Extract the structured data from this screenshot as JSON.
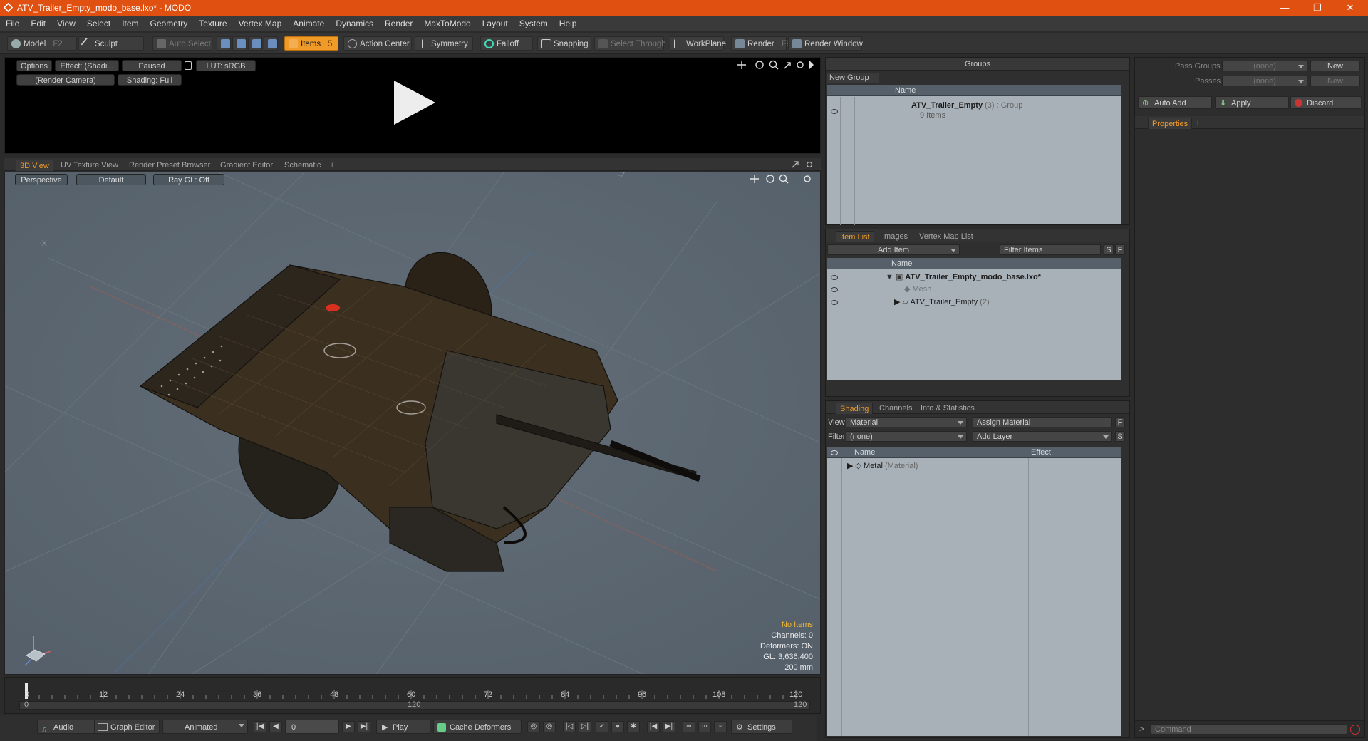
{
  "window": {
    "title": "ATV_Trailer_Empty_modo_base.lxo* - MODO",
    "minimize": "—",
    "restore": "❐",
    "close": "✕"
  },
  "menu": [
    "File",
    "Edit",
    "View",
    "Select",
    "Item",
    "Geometry",
    "Texture",
    "Vertex Map",
    "Animate",
    "Dynamics",
    "Render",
    "MaxToModo",
    "Layout",
    "System",
    "Help"
  ],
  "toolbar": {
    "model": "Model",
    "model_key": "F2",
    "sculpt": "Sculpt",
    "auto_select": "Auto Select",
    "items": "Items",
    "items_key": "5",
    "action_center": "Action Center",
    "symmetry": "Symmetry",
    "falloff": "Falloff",
    "snapping": "Snapping",
    "select_through": "Select Through",
    "workplane": "WorkPlane",
    "render": "Render",
    "render_key": "F9",
    "render_window": "Render Window"
  },
  "preview": {
    "options": "Options",
    "effect": "Effect: (Shadi...",
    "paused": "Paused",
    "lut": "LUT: sRGB",
    "camera": "(Render Camera)",
    "shading": "Shading: Full"
  },
  "viewport_tabs": [
    "3D View",
    "UV Texture View",
    "Render Preset Browser",
    "Gradient Editor",
    "Schematic"
  ],
  "viewport": {
    "perspective": "Perspective",
    "default": "Default",
    "raygl": "Ray GL: Off",
    "axis_x": "-X",
    "axis_z": "-Z",
    "hud": {
      "no_items": "No Items",
      "channels": "Channels: 0",
      "deformers": "Deformers: ON",
      "gl": "GL: 3,636,400",
      "size": "200 mm"
    }
  },
  "timeline": {
    "ticks": [
      "0",
      "12",
      "24",
      "36",
      "48",
      "60",
      "72",
      "84",
      "96",
      "108",
      "120"
    ],
    "sub_left": "0",
    "sub_mid": "120",
    "sub_right": "120"
  },
  "bottom": {
    "audio": "Audio",
    "graph_editor": "Graph Editor",
    "animated": "Animated",
    "frame": "0",
    "play": "Play",
    "cache_deformers": "Cache Deformers",
    "settings": "Settings"
  },
  "groups": {
    "title": "Groups",
    "new_group": "New Group",
    "col_name": "Name",
    "item_name": "ATV_Trailer_Empty",
    "item_count": "(3)",
    "item_type": ": Group",
    "item_sub": "9 Items"
  },
  "itemlist": {
    "tabs": [
      "Item List",
      "Images",
      "Vertex Map List"
    ],
    "add_item": "Add Item",
    "filter": "Filter Items",
    "s": "S",
    "f": "F",
    "col_name": "Name",
    "rows": [
      {
        "label": "ATV_Trailer_Empty_modo_base.lxo*"
      },
      {
        "label": "Mesh"
      },
      {
        "label": "ATV_Trailer_Empty",
        "count": "(2)"
      }
    ]
  },
  "shading": {
    "tabs": [
      "Shading",
      "Channels",
      "Info & Statistics"
    ],
    "view_label": "View",
    "view_value": "Material",
    "assign": "Assign Material",
    "f": "F",
    "filter_label": "Filter",
    "filter_value": "(none)",
    "add_layer": "Add Layer",
    "s": "S",
    "col_name": "Name",
    "col_effect": "Effect",
    "row_name": "Metal",
    "row_type": "(Material)"
  },
  "right": {
    "pass_groups": "Pass Groups",
    "passes": "Passes",
    "none1": "(none)",
    "none2": "(none)",
    "new1": "New",
    "new2": "New",
    "auto_add": "Auto Add",
    "apply": "Apply",
    "discard": "Discard",
    "properties": "Properties",
    "command": "Command"
  },
  "colors": {
    "accent": "#f09a28",
    "titlebar": "#e05010"
  }
}
